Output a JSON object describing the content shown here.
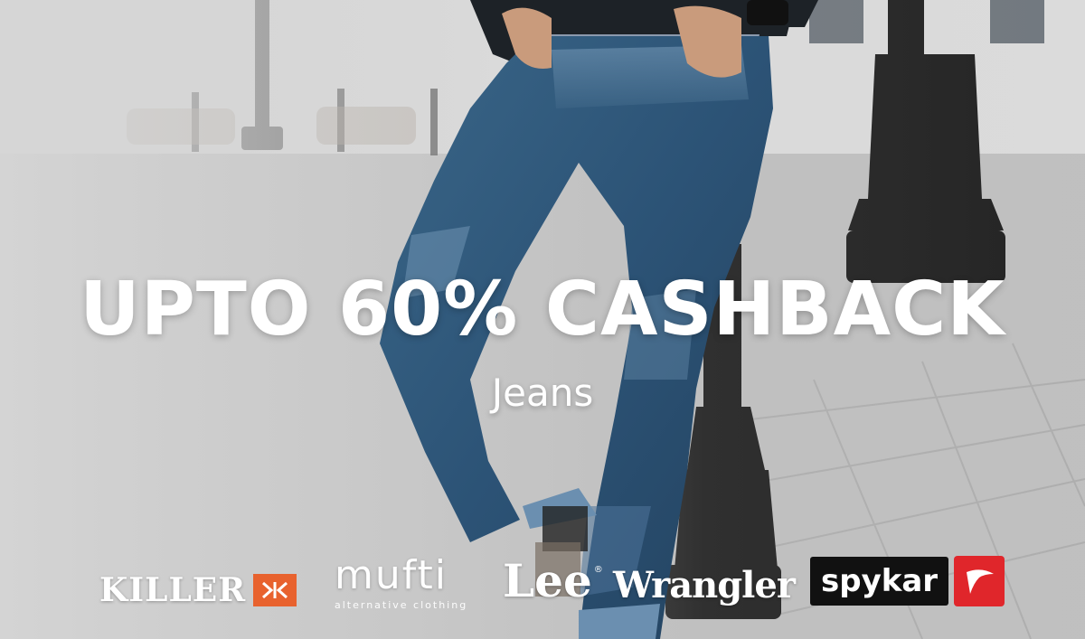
{
  "banner": {
    "headline": "UPTO 60% CASHBACK",
    "subhead": "Jeans"
  },
  "brands": [
    {
      "name": "KILLER",
      "icon": "killer-chevron-logo",
      "accent": "#e8622e"
    },
    {
      "name": "mufti",
      "tagline": "alternative clothing",
      "icon": "mufti-logo"
    },
    {
      "name": "Lee",
      "mark": "®",
      "icon": "lee-logo"
    },
    {
      "name": "Wrangler",
      "icon": "wrangler-logo"
    },
    {
      "name": "spykar",
      "icon": "spykar-logo",
      "accent": "#e0262b"
    }
  ],
  "colors": {
    "text": "#ffffff",
    "killer_orange": "#e8622e",
    "spykar_red": "#e0262b",
    "denim": "#2f5678"
  }
}
